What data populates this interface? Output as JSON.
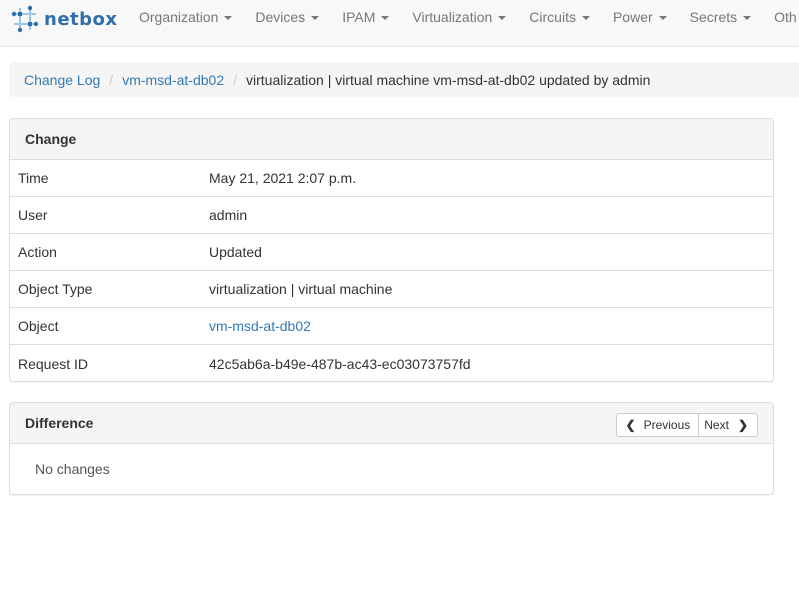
{
  "brand": {
    "name": "netbox",
    "logo_icon": "netbox-logo-icon"
  },
  "nav": {
    "items": [
      {
        "label": "Organization"
      },
      {
        "label": "Devices"
      },
      {
        "label": "IPAM"
      },
      {
        "label": "Virtualization"
      },
      {
        "label": "Circuits"
      },
      {
        "label": "Power"
      },
      {
        "label": "Secrets"
      },
      {
        "label": "Oth"
      }
    ]
  },
  "breadcrumb": {
    "items": [
      {
        "label": "Change Log"
      },
      {
        "label": "vm-msd-at-db02"
      }
    ],
    "active": "virtualization | virtual machine vm-msd-at-db02 updated by admin"
  },
  "change_panel": {
    "title": "Change",
    "rows": [
      {
        "label": "Time",
        "value": "May 21, 2021 2:07 p.m."
      },
      {
        "label": "User",
        "value": "admin"
      },
      {
        "label": "Action",
        "value": "Updated"
      },
      {
        "label": "Object Type",
        "value": "virtualization | virtual machine"
      },
      {
        "label": "Object",
        "value": "vm-msd-at-db02"
      },
      {
        "label": "Request ID",
        "value": "42c5ab6a-b49e-487b-ac43-ec03073757fd"
      }
    ]
  },
  "difference_panel": {
    "title": "Difference",
    "previous_label": "Previous",
    "next_label": "Next",
    "body": "No changes"
  },
  "colors": {
    "link": "#337ab7",
    "nav_text": "#777777",
    "navbar_bg": "#f8f8f8",
    "panel_heading_bg": "#f5f5f5"
  }
}
